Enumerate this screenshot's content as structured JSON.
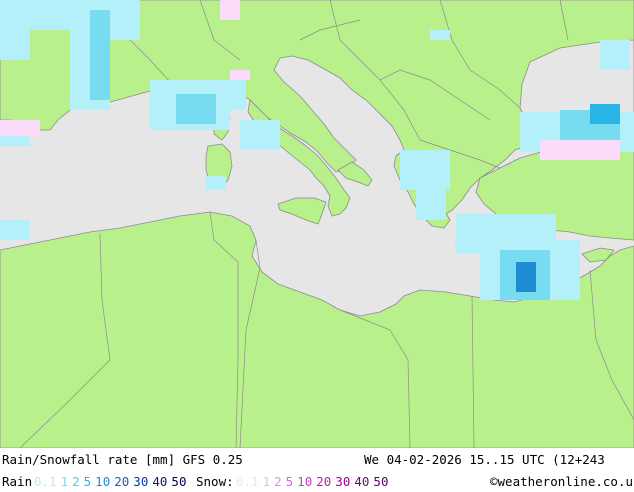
{
  "footer": {
    "title": "Rain/Snowfall rate [mm] GFS 0.25",
    "datetime": "We 04-02-2026 15..15 UTC (12+243",
    "rain_label": "Rain",
    "snow_label": "Snow:",
    "credit": "©weatheronline.co.uk"
  },
  "legend": {
    "rain": [
      {
        "v": "0.1",
        "c": "#b4f0fa"
      },
      {
        "v": "1",
        "c": "#78dcf0"
      },
      {
        "v": "2",
        "c": "#50c8f0"
      },
      {
        "v": "5",
        "c": "#28b4e6"
      },
      {
        "v": "10",
        "c": "#1e8cd2"
      },
      {
        "v": "20",
        "c": "#1464b4"
      },
      {
        "v": "30",
        "c": "#0a3c96"
      },
      {
        "v": "40",
        "c": "#001e78"
      },
      {
        "v": "50",
        "c": "#000050"
      }
    ],
    "snow": [
      {
        "v": "0.1",
        "c": "#fadcfa"
      },
      {
        "v": "1",
        "c": "#f0b4f0"
      },
      {
        "v": "2",
        "c": "#e68ce6"
      },
      {
        "v": "5",
        "c": "#dc64dc"
      },
      {
        "v": "10",
        "c": "#c83cc8"
      },
      {
        "v": "20",
        "c": "#b41eb4"
      },
      {
        "v": "30",
        "c": "#960096"
      },
      {
        "v": "40",
        "c": "#780078"
      },
      {
        "v": "50",
        "c": "#5a005a"
      }
    ]
  },
  "colors": {
    "land": "#b8f08c",
    "sea": "#e6e6e6",
    "border": "#8c8c8c",
    "coast": "#8c8c8c"
  }
}
